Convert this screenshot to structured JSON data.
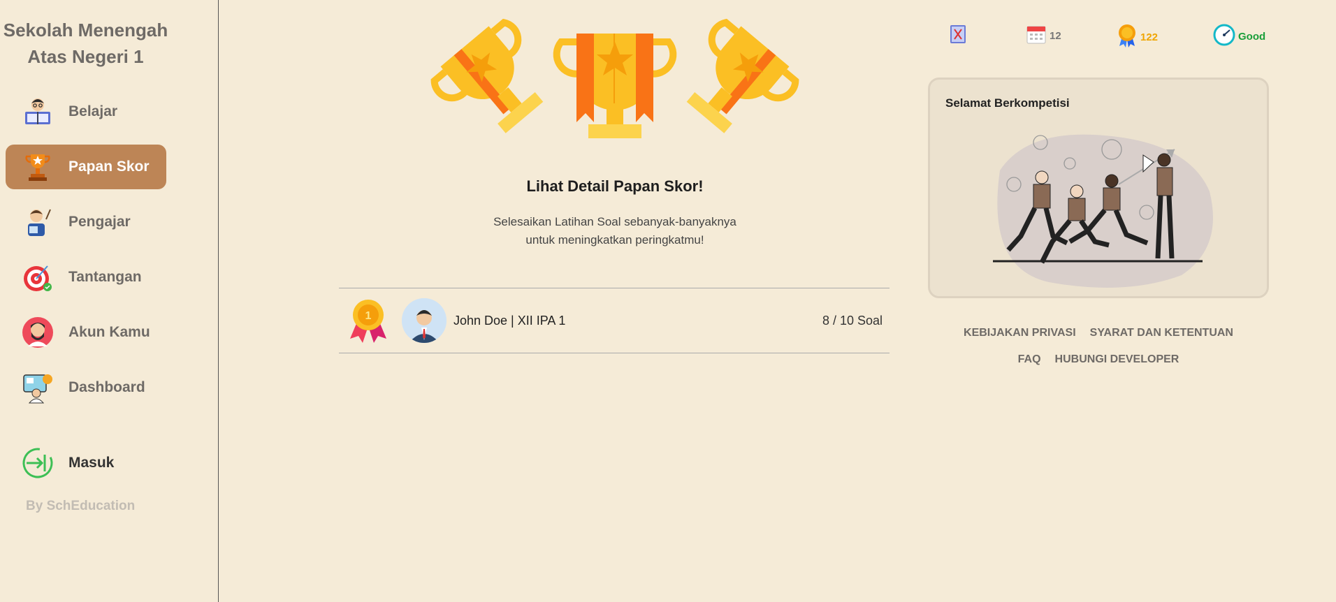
{
  "sidebar": {
    "school_line1": "Sekolah Menengah",
    "school_line2": "Atas Negeri 1",
    "items": [
      {
        "label": "Belajar",
        "icon": "reading-student-icon"
      },
      {
        "label": "Papan Skor",
        "icon": "trophy-icon",
        "active": true
      },
      {
        "label": "Pengajar",
        "icon": "teacher-icon"
      },
      {
        "label": "Tantangan",
        "icon": "target-icon"
      },
      {
        "label": "Akun Kamu",
        "icon": "user-avatar-icon"
      },
      {
        "label": "Dashboard",
        "icon": "dashboard-icon"
      }
    ],
    "login_label": "Masuk",
    "by_label": "By SchEducation"
  },
  "main": {
    "title": "Lihat Detail Papan Skor!",
    "subtitle_line1": "Selesaikan Latihan Soal sebanyak-banyaknya",
    "subtitle_line2": "untuk meningkatkan peringkatmu!",
    "leaderboard": [
      {
        "rank_icon": "gold-medal-icon",
        "name": "John Doe | XII IPA 1",
        "score": "8 / 10 Soal"
      }
    ]
  },
  "stats": {
    "book_icon": "book-icon",
    "calendar_value": "12",
    "badge_value": "122",
    "performance_value": "Good",
    "colors": {
      "calendar": "#777777",
      "badge": "#f0a500",
      "performance": "#1a9e3a"
    }
  },
  "card": {
    "title": "Selamat Berkompetisi",
    "illustration": "competition-illustration"
  },
  "footer_links": {
    "privacy": "KEBIJAKAN PRIVASI",
    "terms": "SYARAT DAN KETENTUAN",
    "faq": "FAQ",
    "contact": "HUBUNGI DEVELOPER"
  },
  "colors": {
    "background": "#f5ebd7",
    "active_nav": "#bd8556"
  }
}
